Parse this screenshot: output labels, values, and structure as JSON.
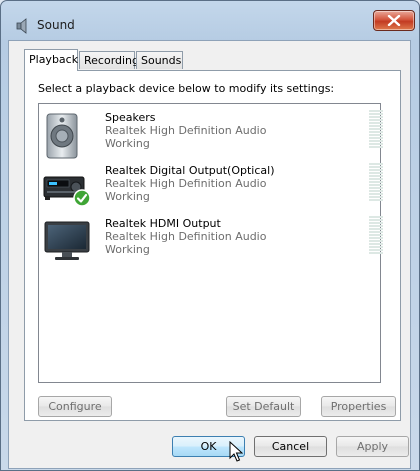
{
  "window": {
    "title": "Sound"
  },
  "tabs": [
    {
      "label": "Playback",
      "active": true
    },
    {
      "label": "Recording",
      "active": false
    },
    {
      "label": "Sounds",
      "active": false
    }
  ],
  "playback": {
    "instruction": "Select a playback device below to modify its settings:",
    "devices": [
      {
        "name": "Speakers",
        "description": "Realtek High Definition Audio",
        "status": "Working",
        "icon": "speaker-icon",
        "is_default": false
      },
      {
        "name": "Realtek Digital Output(Optical)",
        "description": "Realtek High Definition Audio",
        "status": "Working",
        "icon": "digital-output-icon",
        "is_default": true
      },
      {
        "name": "Realtek HDMI Output",
        "description": "Realtek High Definition Audio",
        "status": "Working",
        "icon": "hdmi-monitor-icon",
        "is_default": false
      }
    ],
    "buttons": {
      "configure": "Configure",
      "set_default": "Set Default",
      "properties": "Properties"
    }
  },
  "dialog_buttons": {
    "ok": "OK",
    "cancel": "Cancel",
    "apply": "Apply"
  },
  "colors": {
    "close_button": "#c23b22",
    "default_button_border": "#3c7fb1",
    "check_badge": "#3fa535"
  }
}
